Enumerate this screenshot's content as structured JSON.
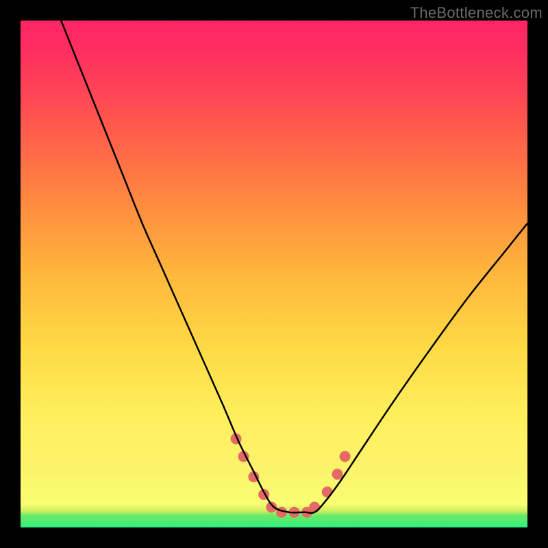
{
  "watermark": "TheBottleneck.com",
  "chart_data": {
    "type": "line",
    "title": "",
    "xlabel": "",
    "ylabel": "",
    "xlim": [
      0,
      100
    ],
    "ylim": [
      0,
      100
    ],
    "grid": false,
    "legend": false,
    "series": [
      {
        "name": "curve",
        "color": "#000000",
        "stroke_width": 2.5,
        "x": [
          8,
          12,
          16,
          20,
          24,
          28,
          32,
          36,
          40,
          43,
          46,
          48,
          50,
          53,
          56,
          58,
          60,
          63,
          67,
          73,
          80,
          88,
          96,
          100
        ],
        "y": [
          100,
          90,
          80,
          70,
          60,
          51,
          42,
          33,
          24,
          17,
          11,
          7,
          4,
          3,
          3,
          3,
          5,
          9,
          15,
          24,
          34,
          45,
          55,
          60
        ]
      }
    ],
    "markers": {
      "name": "highlight-dots",
      "color": "#e66a64",
      "radius_base": 8,
      "points": [
        {
          "x": 42.5,
          "y": 17.5
        },
        {
          "x": 44.0,
          "y": 14.0
        },
        {
          "x": 46.0,
          "y": 10.0
        },
        {
          "x": 48.0,
          "y": 6.5
        },
        {
          "x": 49.5,
          "y": 4.0
        },
        {
          "x": 51.5,
          "y": 3.0
        },
        {
          "x": 54.0,
          "y": 3.0
        },
        {
          "x": 56.5,
          "y": 3.0
        },
        {
          "x": 58.0,
          "y": 4.0
        },
        {
          "x": 60.5,
          "y": 7.0
        },
        {
          "x": 62.5,
          "y": 10.5
        },
        {
          "x": 64.0,
          "y": 14.0
        }
      ]
    }
  }
}
